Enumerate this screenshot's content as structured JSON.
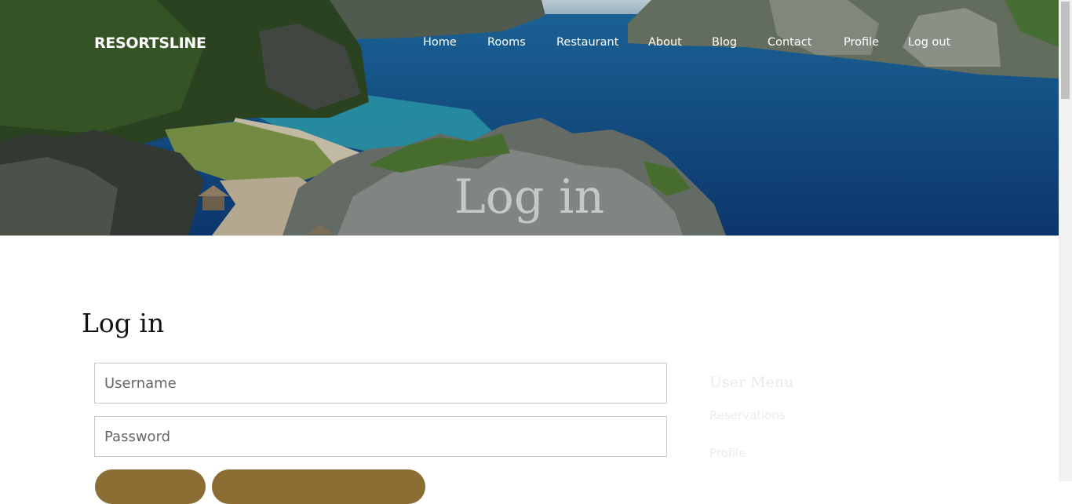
{
  "brand": "RESORTSLINE",
  "nav": [
    {
      "label": "Home"
    },
    {
      "label": "Rooms"
    },
    {
      "label": "Restaurant"
    },
    {
      "label": "About"
    },
    {
      "label": "Blog"
    },
    {
      "label": "Contact"
    },
    {
      "label": "Profile"
    },
    {
      "label": "Log out"
    }
  ],
  "hero": {
    "title": "Log in"
  },
  "login": {
    "heading": "Log in",
    "username_placeholder": "Username",
    "password_placeholder": "Password",
    "username_value": "",
    "password_value": ""
  },
  "sidebar": {
    "title": "User Menu",
    "links": [
      "Reservations",
      "Profile"
    ]
  },
  "colors": {
    "accent": "#8c6d33"
  }
}
